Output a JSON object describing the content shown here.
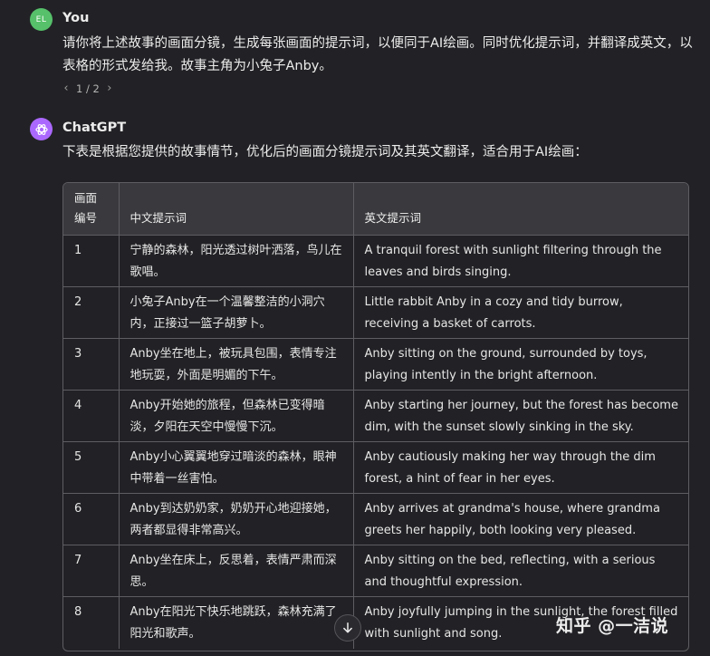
{
  "user_message": {
    "avatar_initials": "EL",
    "sender": "You",
    "text": "请你将上述故事的画面分镜，生成每张画面的提示词，以便同于AI绘画。同时优化提示词，并翻译成英文，以表格的形式发给我。故事主角为小兔子Anby。",
    "pager": {
      "label": "1 / 2"
    }
  },
  "assistant_message": {
    "sender": "ChatGPT",
    "intro": "下表是根据您提供的故事情节，优化后的画面分镜提示词及其英文翻译，适合用于AI绘画：",
    "table": {
      "headers": [
        "画面编号",
        "中文提示词",
        "英文提示词"
      ],
      "rows": [
        {
          "num": "1",
          "cn": "宁静的森林，阳光透过树叶洒落，鸟儿在歌唱。",
          "en": "A tranquil forest with sunlight filtering through the leaves and birds singing."
        },
        {
          "num": "2",
          "cn": "小兔子Anby在一个温馨整洁的小洞穴内，正接过一篮子胡萝卜。",
          "en": "Little rabbit Anby in a cozy and tidy burrow, receiving a basket of carrots."
        },
        {
          "num": "3",
          "cn": "Anby坐在地上，被玩具包围，表情专注地玩耍，外面是明媚的下午。",
          "en": "Anby sitting on the ground, surrounded by toys, playing intently in the bright afternoon."
        },
        {
          "num": "4",
          "cn": "Anby开始她的旅程，但森林已变得暗淡，夕阳在天空中慢慢下沉。",
          "en": "Anby starting her journey, but the forest has become dim, with the sunset slowly sinking in the sky."
        },
        {
          "num": "5",
          "cn": "Anby小心翼翼地穿过暗淡的森林，眼神中带着一丝害怕。",
          "en": "Anby cautiously making her way through the dim forest, a hint of fear in her eyes."
        },
        {
          "num": "6",
          "cn": "Anby到达奶奶家，奶奶开心地迎接她，两者都显得非常高兴。",
          "en": "Anby arrives at grandma's house, where grandma greets her happily, both looking very pleased."
        },
        {
          "num": "7",
          "cn": "Anby坐在床上，反思着，表情严肃而深思。",
          "en": "Anby sitting on the bed, reflecting, with a serious and thoughtful expression."
        },
        {
          "num": "8",
          "cn": "Anby在阳光下快乐地跳跃，森林充满了阳光和歌声。",
          "en": "Anby joyfully jumping in the sunlight, the forest filled with sunlight and song."
        }
      ]
    }
  },
  "watermark": "知乎 @一洁说",
  "icons": {
    "assistant_avatar": "openai-logo-icon",
    "pager_prev": "chevron-left-icon",
    "pager_next": "chevron-right-icon",
    "scroll": "arrow-down-icon"
  },
  "colors": {
    "background": "#222226",
    "user_avatar": "#56c06a",
    "assistant_avatar": "#ab68ff",
    "table_header": "#3a3a3e",
    "table_border": "#5e5e62"
  }
}
